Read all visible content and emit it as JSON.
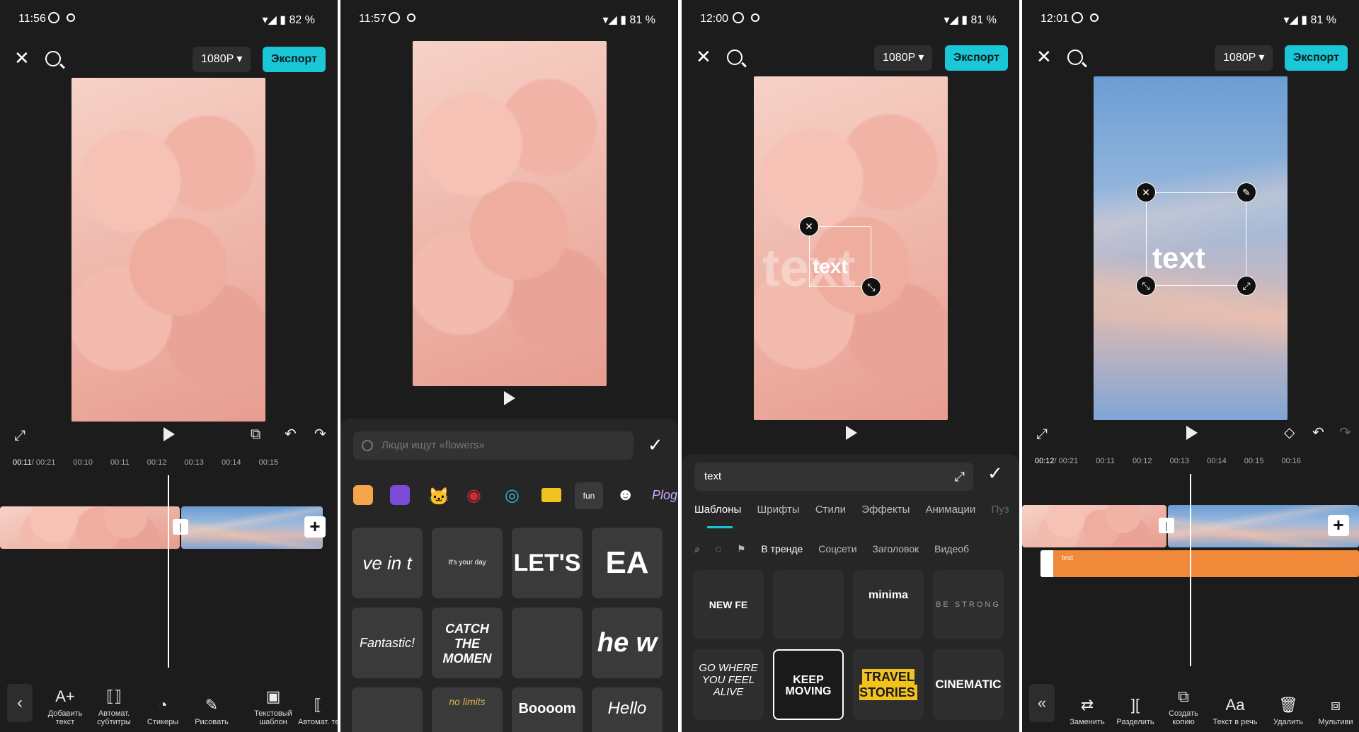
{
  "panels": [
    {
      "status": {
        "time": "11:56",
        "battery": "82 %"
      },
      "resolution": "1080P ▾",
      "export": "Экспорт",
      "ruler": {
        "current": "00:11",
        "total": " / 00:21",
        "ticks": [
          "00:10",
          "00:11",
          "00:12",
          "00:13",
          "00:14",
          "00:15"
        ]
      },
      "tools": [
        "Добавить текст",
        "Автомат. субтитры",
        "Стикеры",
        "Рисовать",
        "Текстовый шаблон",
        "Автомат. текст"
      ]
    },
    {
      "status": {
        "time": "11:57",
        "battery": "81 %"
      },
      "search_placeholder": "Люди ищут «flowers»",
      "category_label": "Plog",
      "stickers": [
        "ve in t",
        "It's your day",
        "LET'S",
        "EA",
        "Fantastic!",
        "CATCH THE MOMEN",
        "",
        "he w",
        "",
        "no limits",
        "Boooom",
        "Hello"
      ]
    },
    {
      "status": {
        "time": "12:00",
        "battery": "81 %"
      },
      "resolution": "1080P ▾",
      "export": "Экспорт",
      "overlay_text": "text",
      "input_value": "text",
      "tabs": [
        "Шаблоны",
        "Шрифты",
        "Стили",
        "Эффекты",
        "Анимации",
        "Пуз"
      ],
      "subtabs": [
        "В тренде",
        "Соцсети",
        "Заголовок",
        "Видеоб"
      ],
      "templates": [
        "NEW FE",
        "",
        "minima",
        "BE STRONG",
        "GO WHERE YOU FEEL ALIVE",
        "KEEP MOVING",
        "TRAVEL STORIES",
        "CINEMATIC"
      ]
    },
    {
      "status": {
        "time": "12:01",
        "battery": "81 %"
      },
      "resolution": "1080P ▾",
      "export": "Экспорт",
      "overlay_text": "text",
      "ruler": {
        "current": "00:12",
        "total": " / 00:21",
        "ticks": [
          "00:11",
          "00:12",
          "00:13",
          "00:14",
          "00:15",
          "00:16"
        ]
      },
      "text_track": "text",
      "tools": [
        "Заменить",
        "Разделить",
        "Создать копию",
        "Текст в речь",
        "Удалить",
        "Мультиви"
      ]
    }
  ],
  "colors": {
    "accent": "#19c7d6",
    "track": "#f08a3a",
    "panel_bg": "#1c1c1c"
  }
}
